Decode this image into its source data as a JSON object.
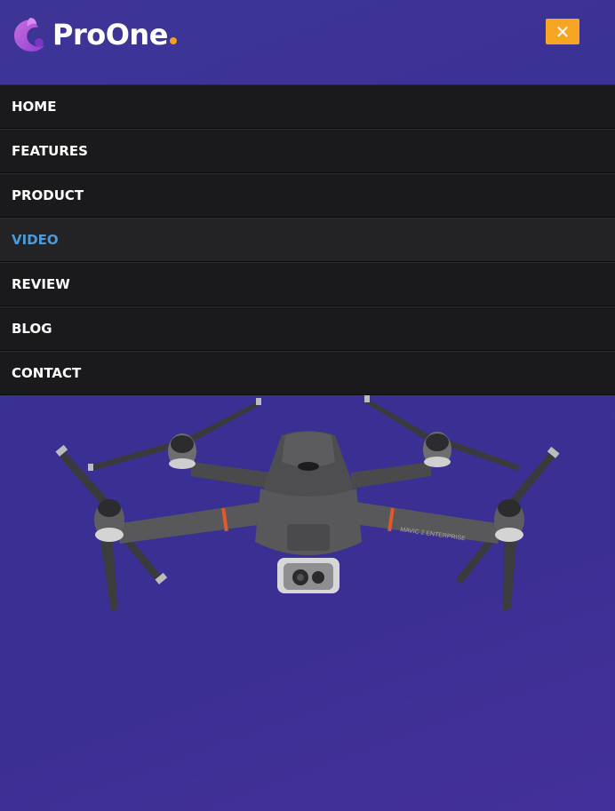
{
  "brand": {
    "name": "ProOne",
    "dot_color": "#f6a11b"
  },
  "close_button": {
    "label": "✕",
    "color": "#f6a623"
  },
  "nav": {
    "items": [
      {
        "label": "HOME",
        "active": false
      },
      {
        "label": "FEATURES",
        "active": false
      },
      {
        "label": "PRODUCT",
        "active": false
      },
      {
        "label": "VIDEO",
        "active": true
      },
      {
        "label": "REVIEW",
        "active": false
      },
      {
        "label": "BLOG",
        "active": false
      },
      {
        "label": "CONTACT",
        "active": false
      }
    ],
    "active_color": "#4c9ad8"
  },
  "hero": {
    "drone_model_text": "MAVIC 2 ENTERPRISE"
  },
  "colors": {
    "background": "#3a3094",
    "menu_bg": "#1a1a1c"
  }
}
